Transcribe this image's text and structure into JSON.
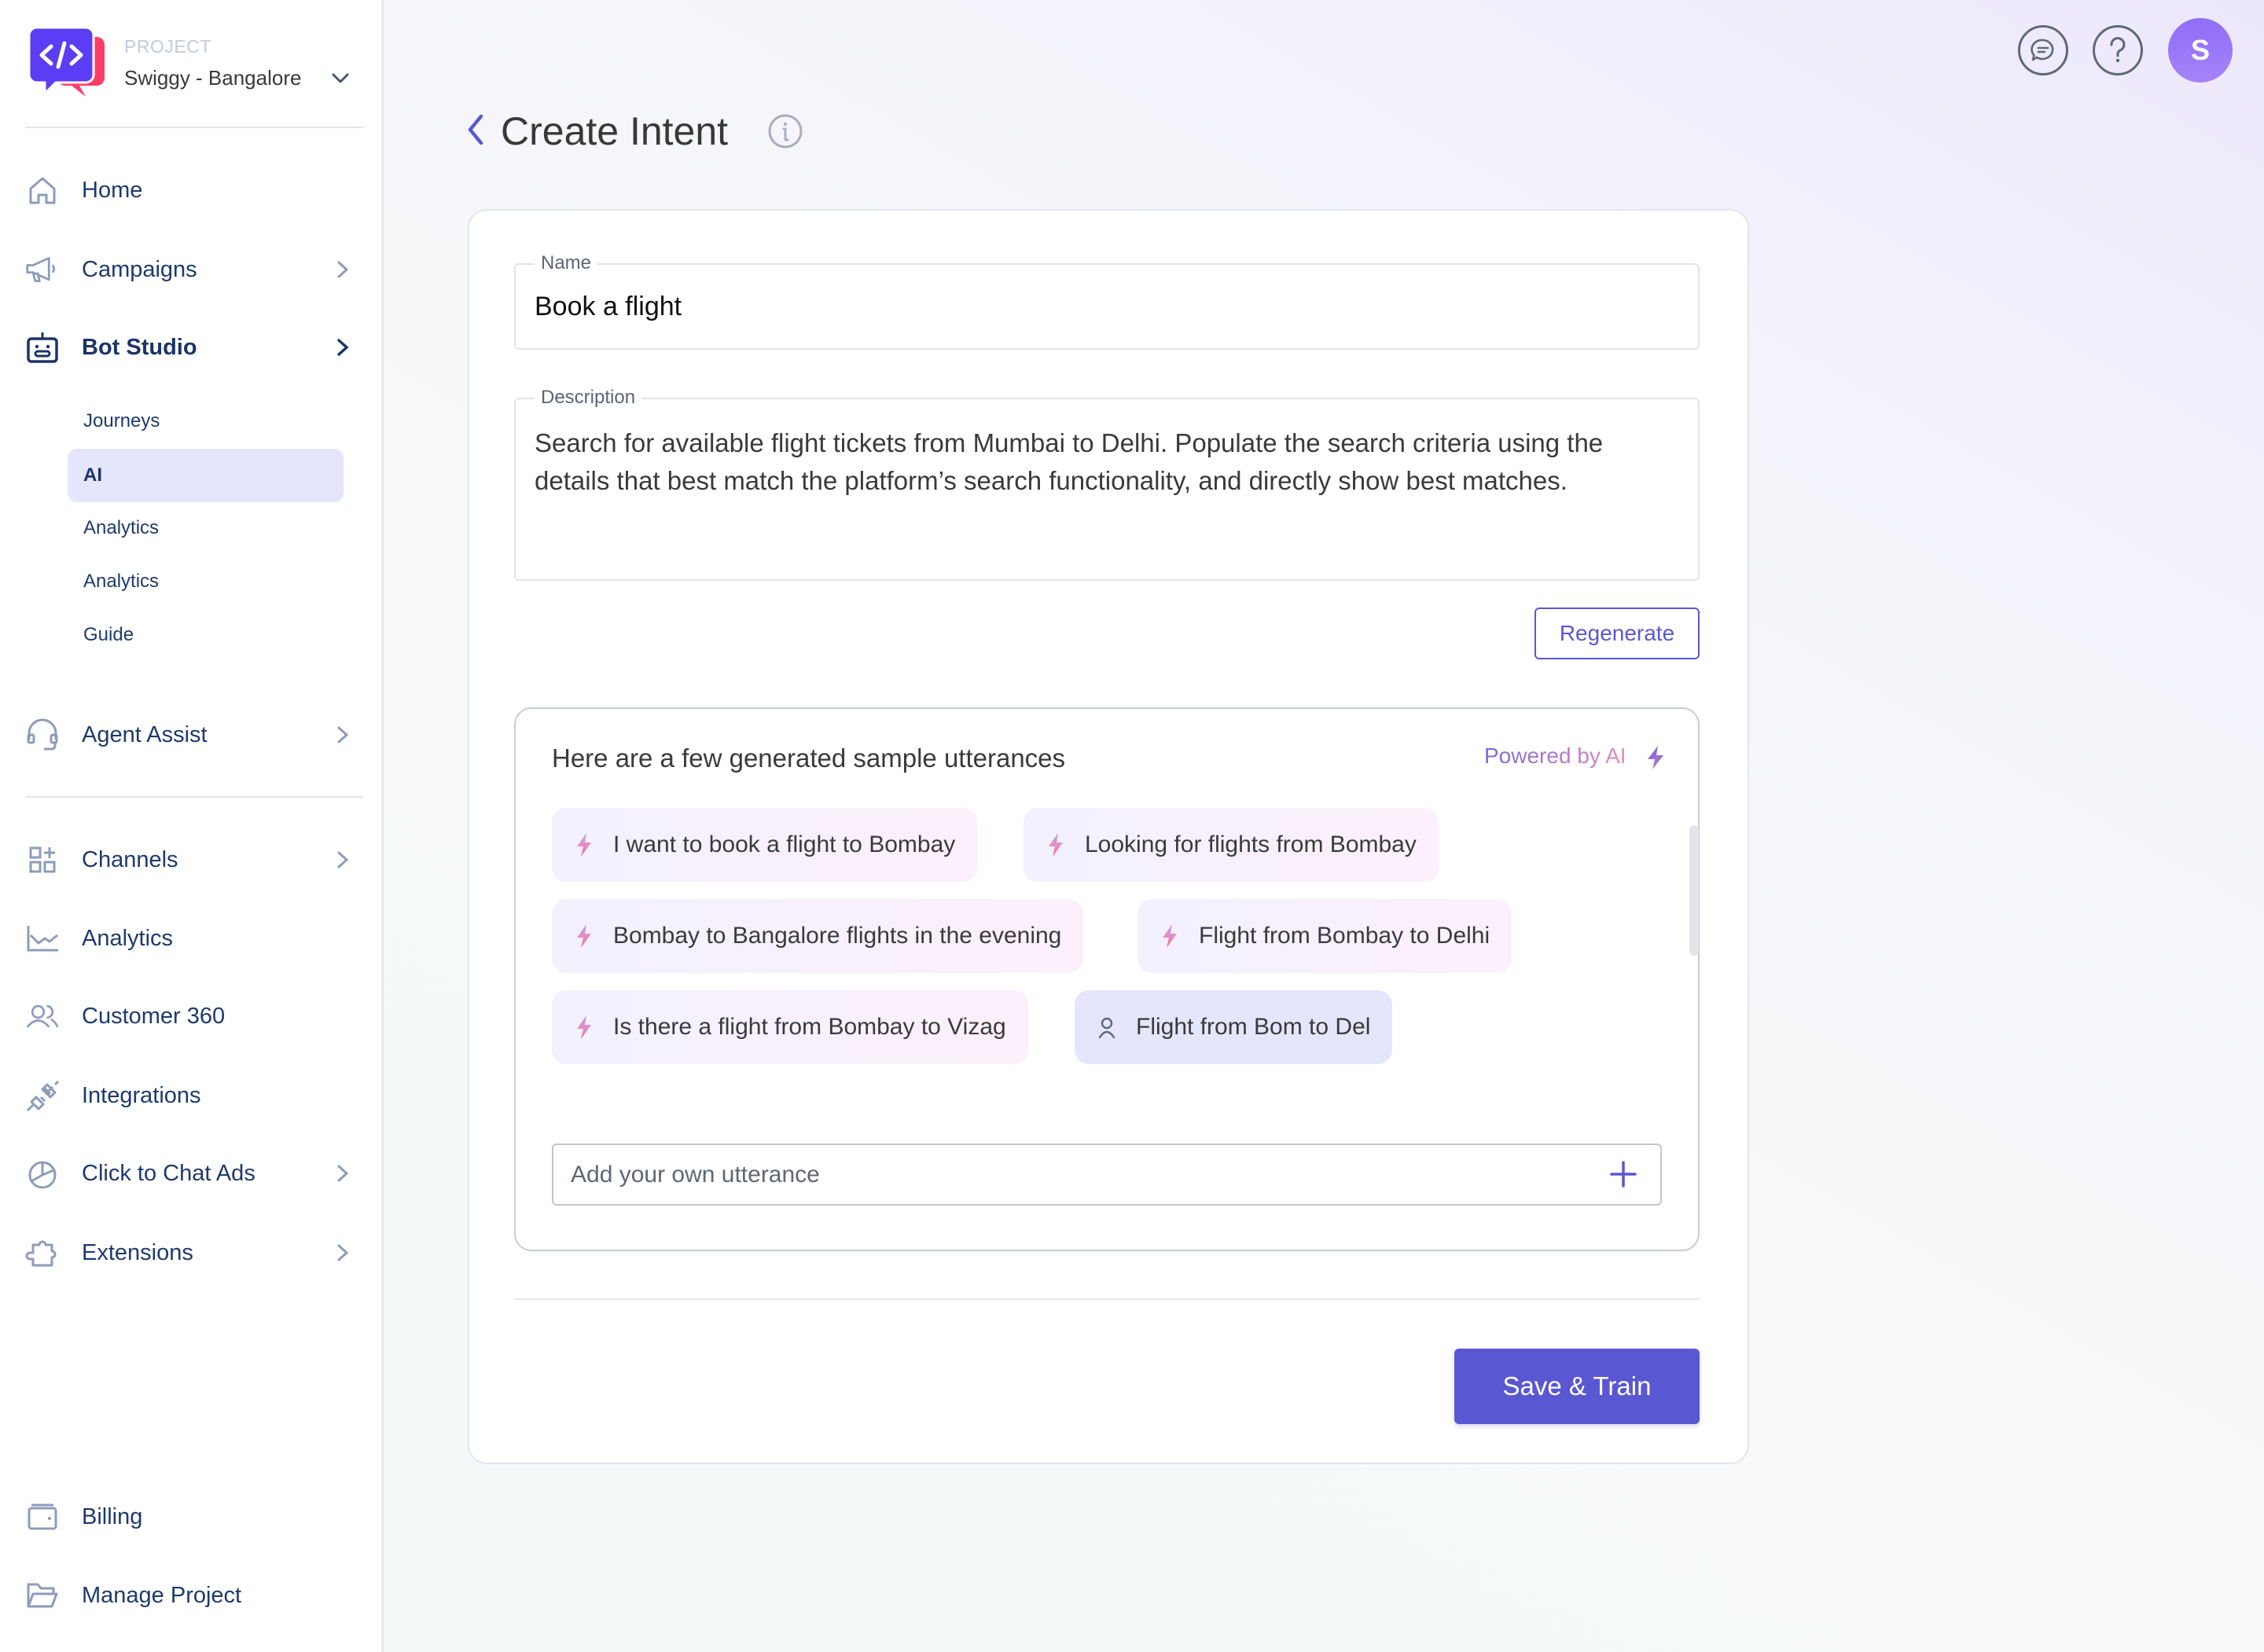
{
  "project": {
    "label": "PROJECT",
    "name": "Swiggy - Bangalore"
  },
  "sidebar": {
    "items": [
      {
        "label": "Home",
        "icon": "home-icon"
      },
      {
        "label": "Campaigns",
        "icon": "megaphone-icon",
        "has_children": true
      },
      {
        "label": "Bot Studio",
        "icon": "bot-icon",
        "has_children": true,
        "active": true
      }
    ],
    "bot_studio_sub": [
      {
        "label": "Journeys"
      },
      {
        "label": "AI",
        "active": true
      },
      {
        "label": "Analytics"
      },
      {
        "label": "Analytics"
      },
      {
        "label": "Guide"
      }
    ],
    "agent_assist": {
      "label": "Agent Assist",
      "icon": "headset-icon"
    },
    "group2": [
      {
        "label": "Channels",
        "icon": "channels-icon",
        "has_children": true
      },
      {
        "label": "Analytics",
        "icon": "chart-line-icon"
      },
      {
        "label": "Customer 360",
        "icon": "users-icon"
      },
      {
        "label": "Integrations",
        "icon": "plug-icon"
      },
      {
        "label": "Click to Chat Ads",
        "icon": "pie-chart-icon",
        "has_children": true
      },
      {
        "label": "Extensions",
        "icon": "puzzle-icon",
        "has_children": true
      }
    ],
    "bottom": [
      {
        "label": "Billing",
        "icon": "wallet-icon"
      },
      {
        "label": "Manage Project",
        "icon": "folder-icon"
      }
    ]
  },
  "header": {
    "avatar_initial": "S",
    "avatar_color": "#9677f8"
  },
  "page": {
    "title": "Create Intent"
  },
  "form": {
    "name_label": "Name",
    "name_value": "Book a flight",
    "description_label": "Description",
    "description_value": "Search for available flight tickets from Mumbai to Delhi. Populate the search criteria using the details that best match the platform’s search functionality, and directly show best matches.",
    "regenerate_label": "Regenerate"
  },
  "utterances": {
    "title": "Here are a few generated sample utterances",
    "powered_by": "Powered by AI",
    "items": [
      {
        "text": "I want to book a flight to Bombay",
        "source": "ai"
      },
      {
        "text": "Looking for flights from Bombay",
        "source": "ai"
      },
      {
        "text": "Bombay to Bangalore flights in the evening",
        "source": "ai"
      },
      {
        "text": "Flight from Bombay to Delhi",
        "source": "ai"
      },
      {
        "text": "Is there a flight from Bombay to Vizag",
        "source": "ai"
      },
      {
        "text": "Flight from Bom to Del",
        "source": "user"
      }
    ],
    "add_placeholder": "Add your own utterance",
    "add_value": ""
  },
  "actions": {
    "save_label": "Save & Train"
  },
  "colors": {
    "accent": "#5a57d2",
    "nav_text": "#1e3a6e",
    "active_bg": "#e5e5fb",
    "logo_purple": "#5b3df5",
    "logo_red": "#ff3d68"
  }
}
